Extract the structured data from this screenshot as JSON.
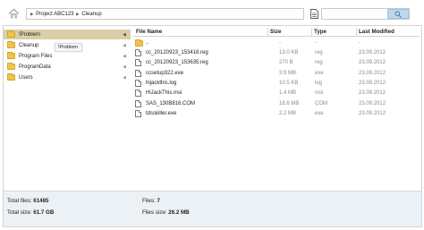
{
  "toolbar": {
    "home_icon": "home-icon",
    "breadcrumb": [
      "Project ABC123",
      "Cleanup"
    ],
    "document_icon": "document-icon",
    "search_placeholder": "",
    "search_icon": "magnifier-icon"
  },
  "sidebar": {
    "items": [
      {
        "label": "!Problem",
        "selected": true
      },
      {
        "label": "Cleanup",
        "selected": false
      },
      {
        "label": "Program Files",
        "selected": false
      },
      {
        "label": "ProgramData",
        "selected": false
      },
      {
        "label": "Users",
        "selected": false
      }
    ],
    "tooltip": "!Problem"
  },
  "file_list": {
    "columns": [
      "File Name",
      "Size",
      "Type",
      "Last Modified"
    ],
    "rows": [
      {
        "name": "..",
        "size": "-",
        "type": "-",
        "modified": "-",
        "icon": "folder-icon"
      },
      {
        "name": "cc_20120923_153418.reg",
        "size": "13.0 KB",
        "type": "reg",
        "modified": "23.09.2012",
        "icon": "file-icon"
      },
      {
        "name": "cc_20120923_153635.reg",
        "size": "270 B",
        "type": "reg",
        "modified": "23.09.2012",
        "icon": "file-icon"
      },
      {
        "name": "ccsetup322.exe",
        "size": "3.9 MB",
        "type": "exe",
        "modified": "23.09.2012",
        "icon": "file-icon"
      },
      {
        "name": "hijackthis.log",
        "size": "10.5 KB",
        "type": "log",
        "modified": "23.09.2012",
        "icon": "file-icon"
      },
      {
        "name": "HiJackThis.msi",
        "size": "1.4 MB",
        "type": "msi",
        "modified": "23.09.2012",
        "icon": "file-icon"
      },
      {
        "name": "SAS_130B816.COM",
        "size": "18.6 MB",
        "type": "COM",
        "modified": "23.09.2012",
        "icon": "file-icon"
      },
      {
        "name": "tdsskiller.exe",
        "size": "2.2 MB",
        "type": "exe",
        "modified": "23.09.2012",
        "icon": "file-icon"
      }
    ]
  },
  "status": {
    "total_files_label": "Total files:",
    "total_files_value": "61485",
    "total_size_label": "Total size:",
    "total_size_value": "61.7 GB",
    "files_label": "Files:",
    "files_value": "7",
    "files_size_label": "Files size:",
    "files_size_value": "26.2 MB"
  },
  "colors": {
    "selected_folder": "#d8cfa6",
    "search_button": "#bcd8ee",
    "status_bar": "#ecf1f6",
    "folder": "#f0c64a"
  }
}
